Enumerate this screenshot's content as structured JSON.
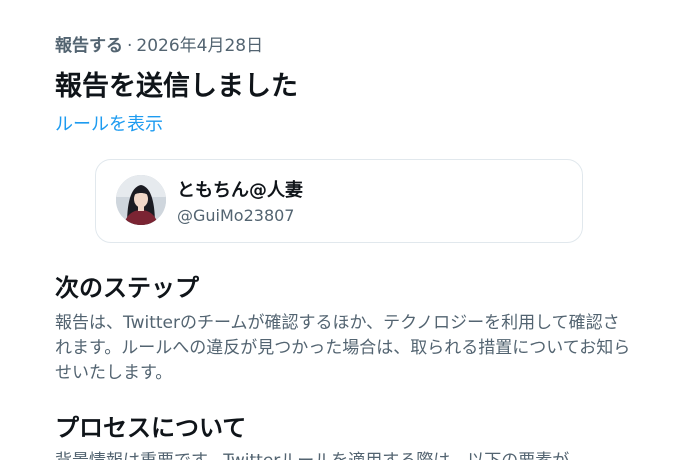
{
  "report": {
    "kind": "報告する",
    "separator": "·",
    "date": "2026年4月28日",
    "title": "報告を送信しました",
    "rules_link": "ルールを表示"
  },
  "reported_user": {
    "display_name": "ともちん@人妻",
    "handle": "@GuiMo23807"
  },
  "next_steps": {
    "heading": "次のステップ",
    "body": "報告は、Twitterのチームが確認するほか、テクノロジーを利用して確認されます。ルールへの違反が見つかった場合は、取られる措置についてお知らせいたします。"
  },
  "process": {
    "heading": "プロセスについて",
    "body_partial": "背景情報は重要です。Twitterルールを適用する際は、以下の要素が"
  },
  "colors": {
    "link": "#1d9bf0",
    "secondary_text": "#536471",
    "primary_text": "#0f1419",
    "card_border": "#e1e8ed"
  }
}
